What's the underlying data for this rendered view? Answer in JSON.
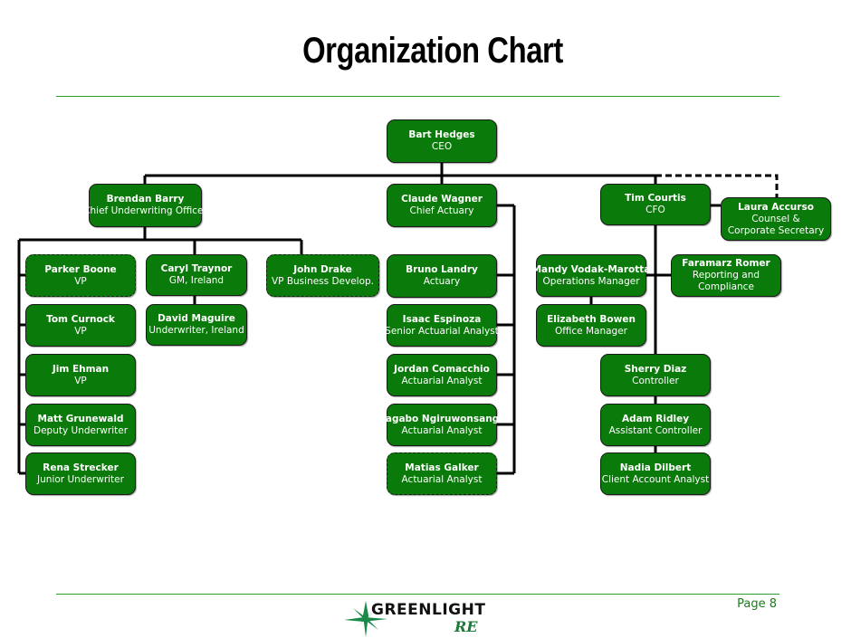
{
  "page": {
    "title": "Organization Chart",
    "page_number": "Page 8",
    "logo": {
      "word": "GREENLIGHT",
      "suffix": "RE",
      "icon": "starburst-icon"
    }
  },
  "colors": {
    "box_fill": "#0a7a0a",
    "rule": "#2e9a2e",
    "page_number": "#1a7a1a",
    "logo_star": "#1a8a4a"
  },
  "org": {
    "ceo": {
      "name": "Bart Hedges",
      "role": "CEO"
    },
    "cuo": {
      "name": "Brendan Barry",
      "role": "Chief Underwriting Officer"
    },
    "actuary_chief": {
      "name": "Claude Wagner",
      "role": "Chief Actuary"
    },
    "cfo": {
      "name": "Tim Courtis",
      "role": "CFO"
    },
    "counsel": {
      "name": "Laura Accurso",
      "role": "Counsel &",
      "role2": "Corporate Secretary"
    },
    "underwriting": [
      {
        "name": "Parker Boone",
        "role": "VP"
      },
      {
        "name": "Tom Curnock",
        "role": "VP"
      },
      {
        "name": "Jim Ehman",
        "role": "VP"
      },
      {
        "name": "Matt Grunewald",
        "role": "Deputy Underwriter"
      },
      {
        "name": "Rena Strecker",
        "role": "Junior Underwriter"
      }
    ],
    "ireland": [
      {
        "name": "Caryl Traynor",
        "role": "GM, Ireland"
      },
      {
        "name": "David Maguire",
        "role": "Underwriter, Ireland"
      }
    ],
    "bizdev": {
      "name": "John Drake",
      "role": "VP Business Develop."
    },
    "actuarial": [
      {
        "name": "Bruno Landry",
        "role": "Actuary"
      },
      {
        "name": "Isaac Espinoza",
        "role": "Senior Actuarial Analyst"
      },
      {
        "name": "Jordan Comacchio",
        "role": "Actuarial Analyst"
      },
      {
        "name": "Kagabo Ngiruwonsanga",
        "role": "Actuarial Analyst"
      },
      {
        "name": "Matias Galker",
        "role": "Actuarial Analyst"
      }
    ],
    "operations": [
      {
        "name": "Mandy Vodak-Marotta",
        "role": "Operations Manager"
      },
      {
        "name": "Elizabeth Bowen",
        "role": "Office Manager"
      }
    ],
    "reporting": {
      "name": "Faramarz Romer",
      "role": "Reporting and",
      "role2": "Compliance"
    },
    "finance": [
      {
        "name": "Sherry Diaz",
        "role": "Controller"
      },
      {
        "name": "Adam Ridley",
        "role": "Assistant Controller"
      },
      {
        "name": "Nadia Dilbert",
        "role": "Client Account Analyst"
      }
    ]
  }
}
